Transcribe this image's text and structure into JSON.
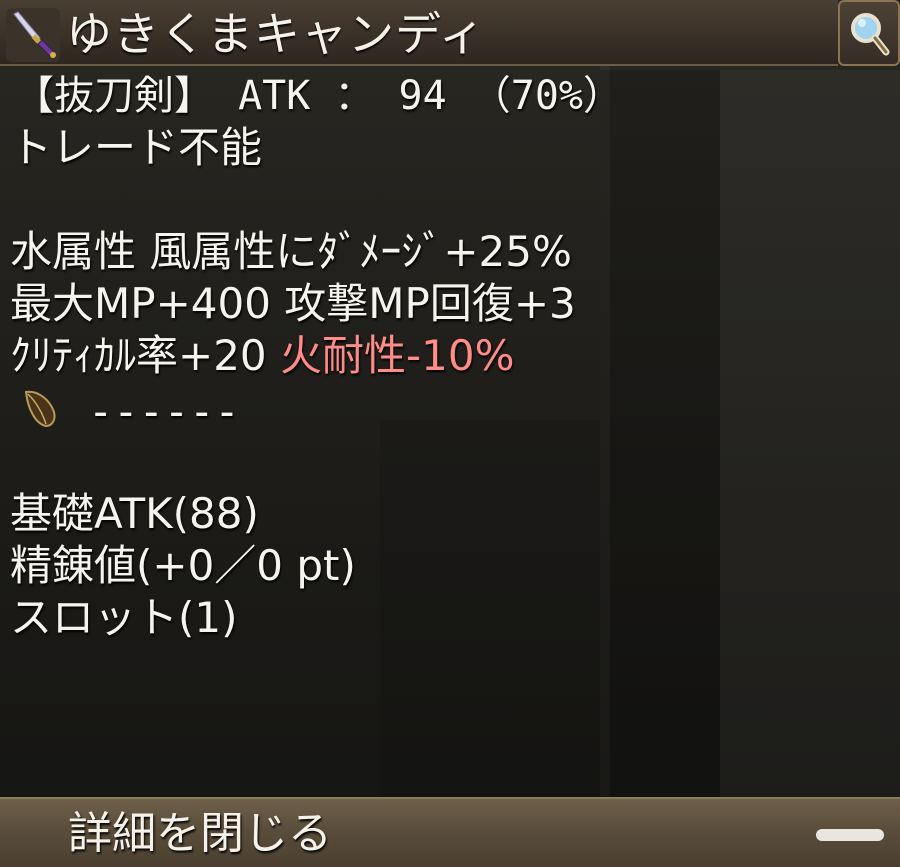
{
  "header": {
    "title": "ゆきくまキャンディ",
    "icon": "sword-icon",
    "search_icon": "magnifier-icon"
  },
  "details": {
    "type_line": "【抜刀剣】 ATK ： 94 （70%）",
    "trade_line": "トレード不能",
    "stats_line1": "水属性 風属性にﾀﾞﾒｰｼﾞ+25%",
    "stats_line2": "最大MP+400 攻撃MP回復+3",
    "stats_line3_normal": "ｸﾘﾃｨｶﾙ率+20 ",
    "stats_line3_red": "火耐性-10%",
    "xtal_line": "------",
    "base_atk": "基礎ATK(88)",
    "refine": "精錬値(+0／0 pt)",
    "slot": "スロット(1)"
  },
  "footer": {
    "close_label": "詳細を閉じる"
  },
  "colors": {
    "text": "#f6f4ee",
    "negative_stat": "#ff8c86",
    "frame": "#8a7453"
  }
}
